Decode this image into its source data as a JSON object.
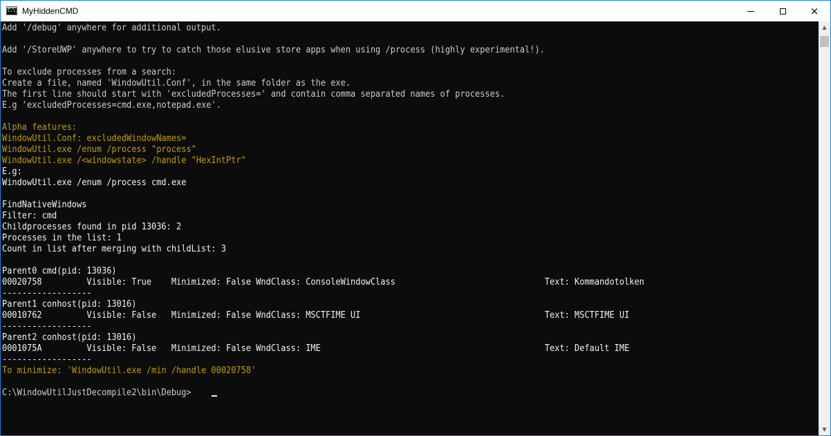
{
  "window": {
    "title": "MyHiddenCMD",
    "icon": "cmd-icon",
    "icon_text": "C:\\."
  },
  "controls": {
    "minimize": "minimize-icon",
    "maximize": "maximize-icon",
    "close": "×"
  },
  "console": {
    "lines": [
      "Add '/debug' anywhere for additional output.",
      "",
      "Add '/StoreUWP' anywhere to try to catch those elusive store apps when using /process (highly experimental!).",
      "",
      "To exclude processes from a search:",
      "Create a file, named 'WindowUtil.Conf', in the same folder as the exe.",
      "The first line should start with 'excludedProcesses=' and contain comma separated names of processes.",
      "E.g 'excludedProcesses=cmd.exe,notepad.exe'.",
      "",
      "Alpha features:",
      "WindowUtil.Conf: excludedWindowNames=",
      "WindowUtil.exe /enum /process \"process\"",
      "WindowUtil.exe /<windowstate> /handle \"HexIntPtr\"",
      "E.g:",
      "WindowUtil.exe /enum /process cmd.exe",
      "",
      "FindNativeWindows",
      "Filter: cmd",
      "Childprocesses found in pid 13036: 2",
      "Processes in the list: 1",
      "Count in list after merging with childList: 3",
      "",
      "Parent0 cmd(pid: 13036)",
      "00020758         Visible: True    Minimized: False WndClass: ConsoleWindowClass                              Text: Kommandotolken",
      "------------------",
      "Parent1 conhost(pid: 13016)",
      "00010762         Visible: False   Minimized: False WndClass: MSCTFIME UI                                     Text: MSCTFIME UI",
      "------------------",
      "Parent2 conhost(pid: 13016)",
      "0001075A         Visible: False   Minimized: False WndClass: IME                                             Text: Default IME",
      "------------------",
      "To minimize: 'WindowUtil.exe /min /handle 00020758'",
      "",
      "C:\\WindowUtilJustDecompile2\\bin\\Debug>"
    ]
  },
  "colors": {
    "console_background": "#0c0c0c",
    "text_gray": "#cccccc",
    "text_white": "#f2f2f2",
    "text_yellow": "#c19c00",
    "window_border": "#1883d7"
  },
  "scrollbar": {
    "up_icon": "▲",
    "down_icon": "▼"
  }
}
